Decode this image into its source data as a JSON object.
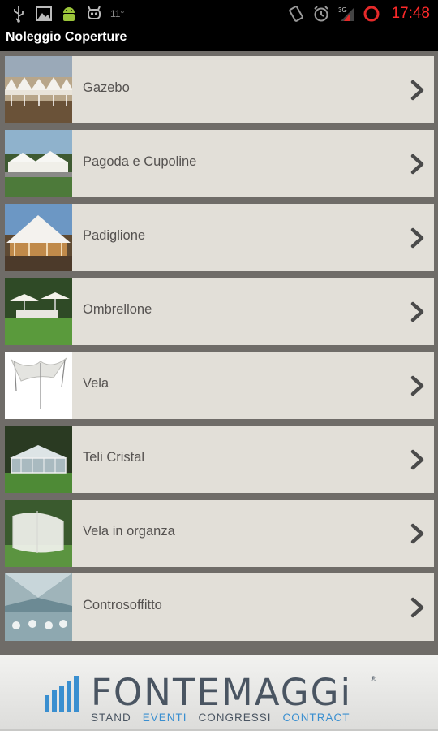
{
  "status_bar": {
    "icons_left": [
      "usb-icon",
      "image-icon",
      "android-icon",
      "bug-icon"
    ],
    "temperature": "11°",
    "icons_right": [
      "rotate-icon",
      "alarm-icon",
      "signal-3g-icon",
      "battery-ring-icon"
    ],
    "clock": "17:48",
    "clock_color": "#ff2a2a"
  },
  "app": {
    "title": "Noleggio Coperture"
  },
  "list": {
    "items": [
      {
        "label": "Gazebo",
        "thumb": "gazebo-tents-photo"
      },
      {
        "label": "Pagoda e Cupoline",
        "thumb": "pagoda-tents-photo"
      },
      {
        "label": "Padiglione",
        "thumb": "pavilion-photo"
      },
      {
        "label": "Ombrellone",
        "thumb": "umbrellas-photo"
      },
      {
        "label": "Vela",
        "thumb": "sail-canopy-photo"
      },
      {
        "label": "Teli Cristal",
        "thumb": "clear-tent-photo"
      },
      {
        "label": "Vela in organza",
        "thumb": "organza-canopy-photo"
      },
      {
        "label": "Controsoffitto",
        "thumb": "ceiling-drape-photo"
      }
    ],
    "chevron_icon": "chevron-right-icon"
  },
  "footer": {
    "brand": "FONTEMAGGi",
    "registered": "®",
    "taglines": [
      {
        "text": "STAND",
        "color": "#4a5562"
      },
      {
        "text": "EVENTI",
        "color": "#3a8fd0"
      },
      {
        "text": "CONGRESSI",
        "color": "#4a5562"
      },
      {
        "text": "CONTRACT",
        "color": "#3a8fd0"
      }
    ]
  }
}
